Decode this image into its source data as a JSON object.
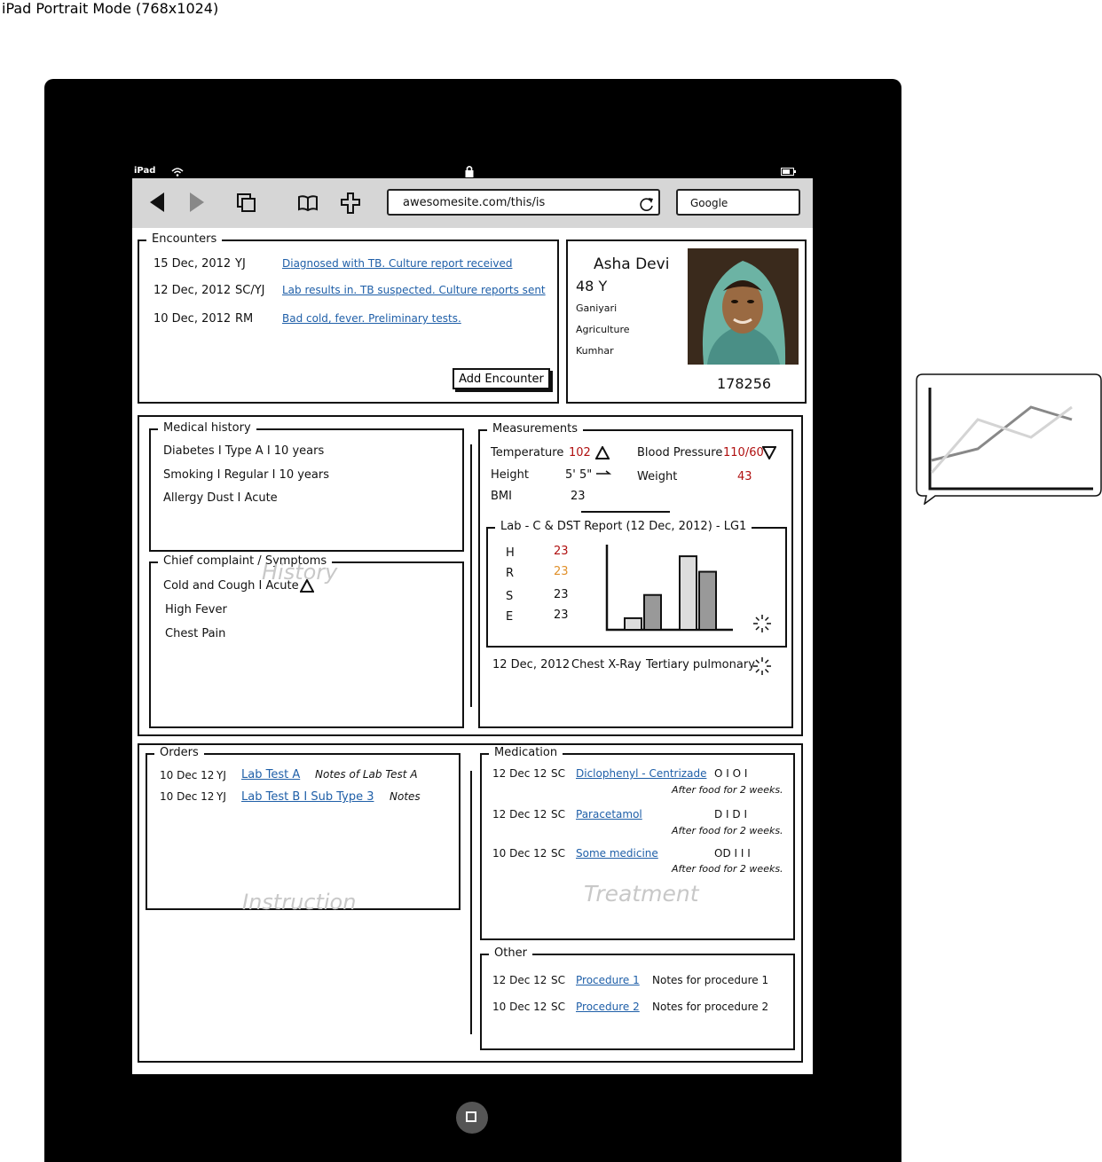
{
  "caption": "iPad Portrait Mode (768x1024)",
  "device": {
    "label": "iPad"
  },
  "browser": {
    "url": "awesomesite.com/this/is",
    "search_placeholder": "Google"
  },
  "encounters": {
    "title": "Encounters",
    "rows": [
      {
        "date": "15 Dec, 2012",
        "by": "YJ",
        "note": "Diagnosed with TB. Culture report received"
      },
      {
        "date": "12 Dec, 2012",
        "by": "SC/YJ",
        "note": "Lab results in. TB suspected. Culture reports sent"
      },
      {
        "date": "10 Dec, 2012",
        "by": "RM",
        "note": "Bad cold, fever. Preliminary tests."
      }
    ],
    "add_button": "Add Encounter"
  },
  "patient": {
    "name": "Asha Devi",
    "age": "48 Y",
    "village": "Ganiyari",
    "occupation": "Agriculture",
    "caste": "Kumhar",
    "id": "178256"
  },
  "history": {
    "watermark": "History",
    "medical": {
      "title": "Medical history",
      "items": [
        "Diabetes  I  Type A  I  10 years",
        "Smoking   I  Regular  I  10 years",
        "Allergy Dust   I  Acute"
      ]
    },
    "complaint": {
      "title": "Chief complaint / Symptoms",
      "items": [
        "Cold and Cough  I  Acute",
        "High Fever",
        "Chest Pain"
      ]
    }
  },
  "measurements": {
    "title": "Measurements",
    "temperature_label": "Temperature",
    "temperature_value": "102",
    "bp_label": "Blood Pressure",
    "bp_value": "110/60",
    "height_label": "Height",
    "height_value": "5' 5\"",
    "weight_label": "Weight",
    "weight_value": "43",
    "bmi_label": "BMI",
    "bmi_value": "23"
  },
  "lab": {
    "title": "Lab - C & DST Report (12 Dec, 2012) - LG1",
    "rows": [
      {
        "label": "H",
        "value": "23",
        "color": "#b01010"
      },
      {
        "label": "R",
        "value": "23",
        "color": "#e0902a"
      },
      {
        "label": "S",
        "value": "23",
        "color": "#111111"
      },
      {
        "label": "E",
        "value": "23",
        "color": "#111111"
      }
    ],
    "xray": {
      "date": "12 Dec, 2012",
      "test": "Chest X-Ray",
      "result": "Tertiary pulmonary"
    }
  },
  "chart_data": {
    "type": "bar",
    "values": [
      3,
      9,
      19,
      15
    ],
    "ylim": [
      0,
      22
    ]
  },
  "orders": {
    "title": "Orders",
    "watermark": "Instruction",
    "rows": [
      {
        "date": "10 Dec 12",
        "by": "YJ",
        "test": "Lab Test A",
        "note": "Notes of Lab Test A"
      },
      {
        "date": "10 Dec 12",
        "by": "YJ",
        "test": "Lab Test B  I Sub Type 3",
        "note": "Notes"
      }
    ]
  },
  "medication": {
    "title": "Medication",
    "watermark": "Treatment",
    "rows": [
      {
        "date": "12 Dec 12",
        "by": "SC",
        "drug": "Diclophenyl - Centrizade",
        "dose": "O   I   O   I",
        "instr": "After food for 2 weeks."
      },
      {
        "date": "12 Dec 12",
        "by": "SC",
        "drug": "Paracetamol",
        "dose": "D   I   D   I",
        "instr": "After food for 2 weeks."
      },
      {
        "date": "10 Dec 12",
        "by": "SC",
        "drug": "Some medicine",
        "dose": "OD   I   I   I",
        "instr": "After food for 2 weeks."
      }
    ]
  },
  "other": {
    "title": "Other",
    "rows": [
      {
        "date": "12 Dec 12",
        "by": "SC",
        "proc": "Procedure 1",
        "note": "Notes for procedure 1"
      },
      {
        "date": "10 Dec 12",
        "by": "SC",
        "proc": "Procedure 2",
        "note": "Notes for procedure 2"
      }
    ]
  }
}
